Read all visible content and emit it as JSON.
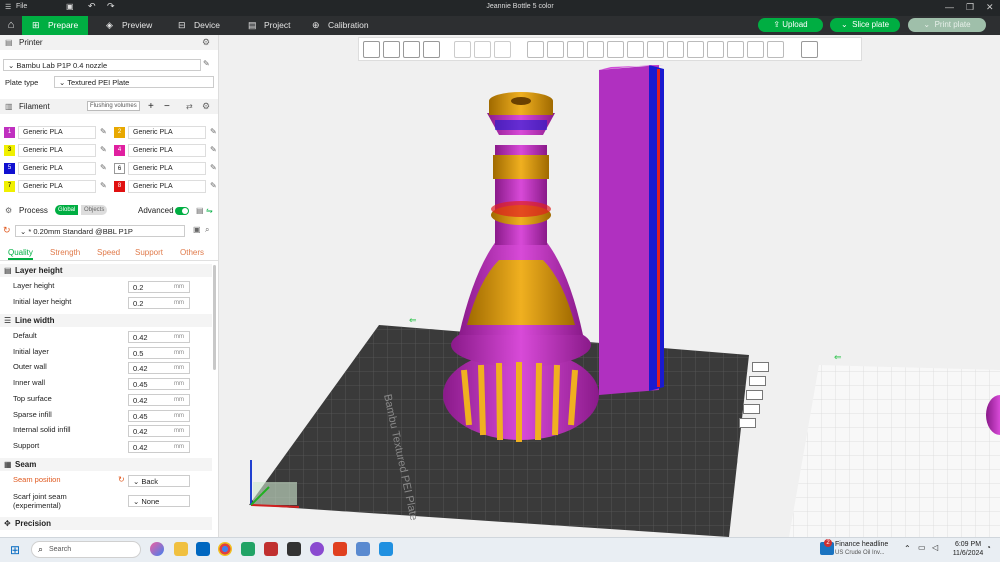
{
  "titlebar": {
    "menu_label": "File",
    "title": "Jeannie Bottle 5 color"
  },
  "tabs": [
    {
      "label": "Prepare",
      "icon": "home-icon"
    },
    {
      "label": "Preview"
    },
    {
      "label": "Device"
    },
    {
      "label": "Project"
    },
    {
      "label": "Calibration"
    }
  ],
  "header_buttons": {
    "upload": "Upload",
    "slice": "Slice plate",
    "print": "Print plate"
  },
  "printer": {
    "section_title": "Printer",
    "name": "Bambu Lab P1P 0.4 nozzle",
    "plate_type_label": "Plate type",
    "plate_type": "Textured PEI Plate"
  },
  "filament": {
    "section_title": "Filament",
    "flushing_label": "Flushing volumes",
    "items": [
      {
        "num": "1",
        "name": "Generic PLA",
        "color": "#c030c0"
      },
      {
        "num": "2",
        "name": "Generic PLA",
        "color": "#e8a800"
      },
      {
        "num": "3",
        "name": "Generic PLA",
        "color": "#f0f000"
      },
      {
        "num": "4",
        "name": "Generic PLA",
        "color": "#e020a0"
      },
      {
        "num": "5",
        "name": "Generic PLA",
        "color": "#1010d0"
      },
      {
        "num": "6",
        "name": "Generic PLA",
        "color": "#ffffff"
      },
      {
        "num": "7",
        "name": "Generic PLA",
        "color": "#f0f000"
      },
      {
        "num": "8",
        "name": "Generic PLA",
        "color": "#e01010"
      }
    ]
  },
  "process": {
    "section_title": "Process",
    "toggle_global": "Global",
    "toggle_objects": "Objects",
    "advanced_label": "Advanced",
    "preset": "* 0.20mm Standard @BBL P1P",
    "subtabs": [
      "Quality",
      "Strength",
      "Speed",
      "Support",
      "Others"
    ],
    "layer_height_group": "Layer height",
    "layer_rows": [
      {
        "label": "Layer height",
        "value": "0.2",
        "unit": "mm"
      },
      {
        "label": "Initial layer height",
        "value": "0.2",
        "unit": "mm"
      }
    ],
    "line_width_group": "Line width",
    "line_rows": [
      {
        "label": "Default",
        "value": "0.42",
        "unit": "mm"
      },
      {
        "label": "Initial layer",
        "value": "0.5",
        "unit": "mm"
      },
      {
        "label": "Outer wall",
        "value": "0.42",
        "unit": "mm"
      },
      {
        "label": "Inner wall",
        "value": "0.45",
        "unit": "mm"
      },
      {
        "label": "Top surface",
        "value": "0.42",
        "unit": "mm"
      },
      {
        "label": "Sparse infill",
        "value": "0.45",
        "unit": "mm"
      },
      {
        "label": "Internal solid infill",
        "value": "0.42",
        "unit": "mm"
      },
      {
        "label": "Support",
        "value": "0.42",
        "unit": "mm"
      }
    ],
    "seam_group": "Seam",
    "seam_position_label": "Seam position",
    "seam_position_value": "Back",
    "scarf_label_1": "Scarf joint seam",
    "scarf_label_2": "(experimental)",
    "scarf_value": "None",
    "precision_group": "Precision"
  },
  "plate_text": "Bambu Textured PEI Plate",
  "taskbar": {
    "search_placeholder": "Search",
    "news_title": "Finance headline",
    "news_sub": "US Crude Oil Inv...",
    "news_badge": "2",
    "time": "6:09 PM",
    "date": "11/6/2024"
  }
}
